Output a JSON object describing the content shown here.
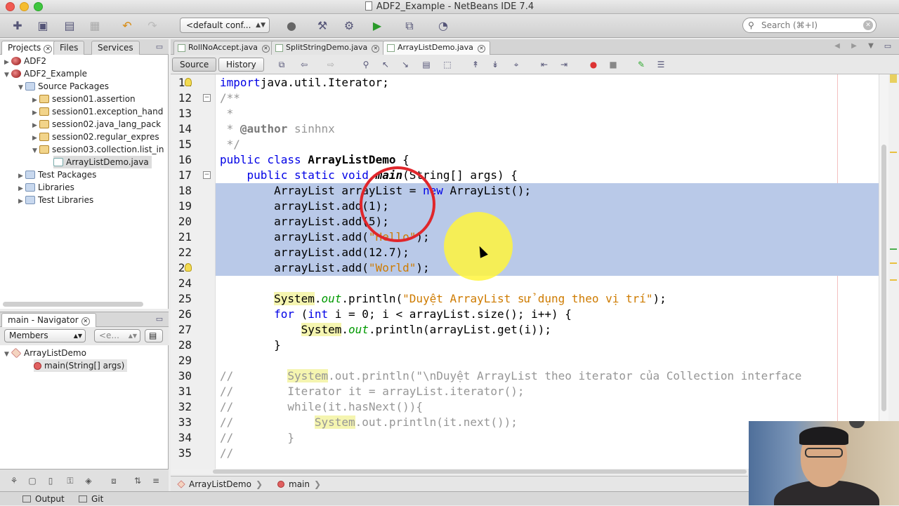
{
  "window": {
    "title": "ADF2_Example - NetBeans IDE 7.4"
  },
  "toolbar": {
    "config_value": "<default conf...",
    "search_placeholder": "Search (⌘+I)"
  },
  "projects_panel": {
    "tabs": [
      "Projects",
      "Files",
      "Services"
    ],
    "tree": [
      {
        "label": "ADF2",
        "level": 0,
        "icon": "project-icon",
        "expanded": false
      },
      {
        "label": "ADF2_Example",
        "level": 0,
        "icon": "project-icon",
        "expanded": true
      },
      {
        "label": "Source Packages",
        "level": 1,
        "icon": "folder-icon",
        "expanded": true
      },
      {
        "label": "session01.assertion",
        "level": 2,
        "icon": "package-icon",
        "expanded": false
      },
      {
        "label": "session01.exception_hand",
        "level": 2,
        "icon": "package-icon",
        "expanded": false
      },
      {
        "label": "session02.java_lang_pack",
        "level": 2,
        "icon": "package-icon",
        "expanded": false
      },
      {
        "label": "session02.regular_expres",
        "level": 2,
        "icon": "package-icon",
        "expanded": false
      },
      {
        "label": "session03.collection.list_in",
        "level": 2,
        "icon": "package-icon",
        "expanded": true
      },
      {
        "label": "ArrayListDemo.java",
        "level": 3,
        "icon": "java-file-icon",
        "expanded": null
      },
      {
        "label": "Test Packages",
        "level": 1,
        "icon": "folder-icon",
        "expanded": false
      },
      {
        "label": "Libraries",
        "level": 1,
        "icon": "folder-icon",
        "expanded": false
      },
      {
        "label": "Test Libraries",
        "level": 1,
        "icon": "folder-icon",
        "expanded": false
      }
    ]
  },
  "navigator": {
    "title": "main - Navigator",
    "members_select": "Members",
    "filter_select": "<e...",
    "tree": [
      {
        "label": "ArrayListDemo"
      },
      {
        "label": "main(String[] args)"
      }
    ]
  },
  "editor": {
    "tabs": [
      {
        "label": "RollNoAccept.java",
        "active": false
      },
      {
        "label": "SplitStringDemo.java",
        "active": false
      },
      {
        "label": "ArrayListDemo.java",
        "active": true
      }
    ],
    "source_button": "Source",
    "history_button": "History",
    "lines": [
      {
        "n": "11",
        "parts": [
          [
            "kw",
            "import"
          ],
          [
            "",
            "java.util.Iterator;"
          ]
        ],
        "indent": ""
      },
      {
        "n": "12",
        "parts": [
          [
            "cm",
            "/**"
          ]
        ],
        "indent": ""
      },
      {
        "n": "13",
        "parts": [
          [
            "cm",
            " *"
          ]
        ],
        "indent": ""
      },
      {
        "n": "14",
        "parts": [
          [
            "cm",
            " * "
          ],
          [
            "an",
            "@author"
          ],
          [
            "cm",
            " sinhnx"
          ]
        ],
        "indent": ""
      },
      {
        "n": "15",
        "parts": [
          [
            "cm",
            " */"
          ]
        ],
        "indent": ""
      },
      {
        "n": "16",
        "parts": [
          [
            "kw",
            "public class "
          ],
          [
            "bold",
            "ArrayListDemo"
          ],
          [
            "",
            " {"
          ]
        ],
        "indent": ""
      },
      {
        "n": "17",
        "parts": [
          [
            "kw",
            "public static void "
          ],
          [
            "it",
            "main"
          ],
          [
            "",
            "(String[] args) {"
          ]
        ],
        "indent": "    "
      },
      {
        "n": "18",
        "parts": [
          [
            "",
            "ArrayList arrayList = "
          ],
          [
            "kw",
            "new"
          ],
          [
            "",
            " ArrayList();"
          ]
        ],
        "indent": "        "
      },
      {
        "n": "19",
        "parts": [
          [
            "",
            "arrayList.add(1);"
          ]
        ],
        "indent": "        "
      },
      {
        "n": "20",
        "parts": [
          [
            "",
            "arrayList.add(5);"
          ]
        ],
        "indent": "        "
      },
      {
        "n": "21",
        "parts": [
          [
            "",
            "arrayList.add("
          ],
          [
            "str",
            "\"Hello\""
          ],
          [
            "",
            ");"
          ]
        ],
        "indent": "        "
      },
      {
        "n": "22",
        "parts": [
          [
            "",
            "arrayList.add(12.7);"
          ]
        ],
        "indent": "        "
      },
      {
        "n": "23",
        "parts": [
          [
            "",
            "arrayList.add("
          ],
          [
            "str",
            "\"World\""
          ],
          [
            "",
            ");"
          ]
        ],
        "indent": "        "
      },
      {
        "n": "24",
        "parts": [],
        "indent": ""
      },
      {
        "n": "25",
        "parts": [
          [
            "hl",
            "System"
          ],
          [
            "",
            "."
          ],
          [
            "fld",
            "out"
          ],
          [
            "",
            ".println("
          ],
          [
            "str",
            "\"Duyệt ArrayList sử dụng theo vị trí\""
          ],
          [
            "",
            ");"
          ]
        ],
        "indent": "        "
      },
      {
        "n": "26",
        "parts": [
          [
            "kw",
            "for"
          ],
          [
            "",
            " ("
          ],
          [
            "kw",
            "int"
          ],
          [
            "",
            " i = 0; i < arrayList.size(); i++) {"
          ]
        ],
        "indent": "        "
      },
      {
        "n": "27",
        "parts": [
          [
            "hl",
            "System"
          ],
          [
            "",
            "."
          ],
          [
            "fld",
            "out"
          ],
          [
            "",
            ".println(arrayList.get(i));"
          ]
        ],
        "indent": "            "
      },
      {
        "n": "28",
        "parts": [
          [
            "",
            "}"
          ]
        ],
        "indent": "        "
      },
      {
        "n": "29",
        "parts": [],
        "indent": ""
      },
      {
        "n": "30",
        "parts": [
          [
            "cm",
            "//        "
          ],
          [
            "hl cm",
            "System"
          ],
          [
            "cm",
            ".out.println(\"\\nDuyệt ArrayList theo iterator của Collection interface"
          ]
        ],
        "indent": ""
      },
      {
        "n": "31",
        "parts": [
          [
            "cm",
            "//        Iterator it = arrayList.iterator();"
          ]
        ],
        "indent": ""
      },
      {
        "n": "32",
        "parts": [
          [
            "cm",
            "//        while(it.hasNext()){"
          ]
        ],
        "indent": ""
      },
      {
        "n": "33",
        "parts": [
          [
            "cm",
            "//            "
          ],
          [
            "hl cm",
            "System"
          ],
          [
            "cm",
            ".out.println(it.next());"
          ]
        ],
        "indent": ""
      },
      {
        "n": "34",
        "parts": [
          [
            "cm",
            "//        }"
          ]
        ],
        "indent": ""
      },
      {
        "n": "35",
        "parts": [
          [
            "cm",
            "//"
          ]
        ],
        "indent": ""
      }
    ],
    "breadcrumbs": [
      "ArrayListDemo",
      "main"
    ]
  },
  "statusbar": {
    "output_label": "Output",
    "git_label": "Git"
  }
}
